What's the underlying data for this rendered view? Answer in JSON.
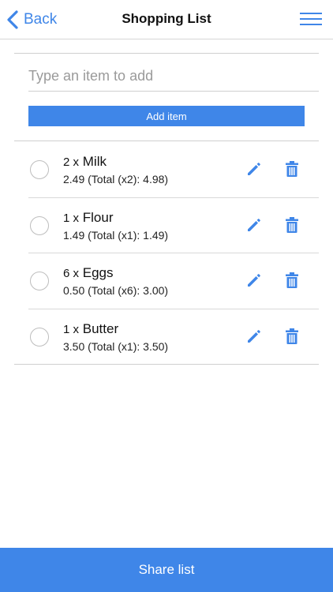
{
  "header": {
    "back_label": "Back",
    "title": "Shopping List"
  },
  "add": {
    "placeholder": "Type an item to add",
    "button_label": "Add item"
  },
  "items": [
    {
      "qty": "2 x",
      "name": "Milk",
      "price": "2.49 (Total (x2): 4.98)"
    },
    {
      "qty": "1 x",
      "name": "Flour",
      "price": "1.49 (Total (x1): 1.49)"
    },
    {
      "qty": "6 x",
      "name": "Eggs",
      "price": "0.50 (Total (x6): 3.00)"
    },
    {
      "qty": "1 x",
      "name": "Butter",
      "price": "3.50 (Total (x1): 3.50)"
    }
  ],
  "footer": {
    "share_label": "Share list"
  },
  "colors": {
    "accent": "#3f86e8"
  },
  "icons": {
    "back": "chevron-left-icon",
    "menu": "hamburger-menu-icon",
    "edit": "pencil-icon",
    "delete": "trash-icon"
  }
}
